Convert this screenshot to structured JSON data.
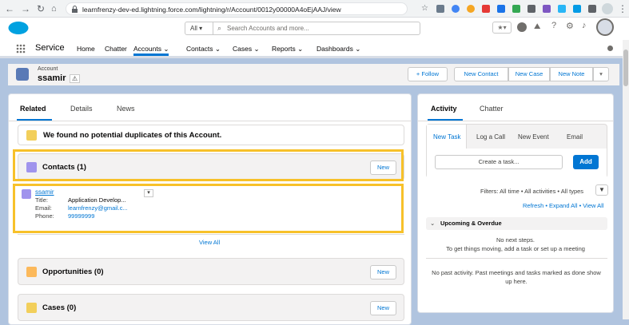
{
  "browser": {
    "url": "learnfrenzy-dev-ed.lightning.force.com/lightning/r/Account/0012y00000A4oEjAAJ/view"
  },
  "header": {
    "search_scope": "All",
    "search_placeholder": "Search Accounts and more..."
  },
  "nav": {
    "app_name": "Service",
    "items": [
      "Home",
      "Chatter",
      "Accounts",
      "Contacts",
      "Cases",
      "Reports",
      "Dashboards"
    ]
  },
  "record": {
    "type_label": "Account",
    "name": "ssamir",
    "buttons": [
      "+ Follow",
      "New Contact",
      "New Case",
      "New Note"
    ]
  },
  "left": {
    "tabs": [
      "Related",
      "Details",
      "News"
    ],
    "duplicates_msg": "We found no potential duplicates of this Account.",
    "contacts": {
      "title": "Contacts (1)",
      "new": "New",
      "name": "ssamir",
      "title_label": "Title:",
      "title_value": "Application Develop...",
      "email_label": "Email:",
      "email_value": "learnfrenzy@gmail.c...",
      "phone_label": "Phone:",
      "phone_value": "99999999",
      "view_all": "View All"
    },
    "opportunities": {
      "title": "Opportunities (0)",
      "new": "New"
    },
    "cases": {
      "title": "Cases (0)",
      "new": "New"
    }
  },
  "right": {
    "tabs": [
      "Activity",
      "Chatter"
    ],
    "subtabs": [
      "New Task",
      "Log a Call",
      "New Event",
      "Email"
    ],
    "task_placeholder": "Create a task...",
    "add": "Add",
    "filters": "Filters: All time • All activities • All types",
    "refresh": "Refresh • Expand All • View All",
    "upcoming": "Upcoming & Overdue",
    "no_next": "No next steps.",
    "no_next_hint": "To get things moving, add a task or set up a meeting",
    "no_past": "No past activity. Past meetings and tasks marked as done show up here."
  },
  "colors": {
    "brand": "#0176d3",
    "highlight": "#f7c12a",
    "contact_icon": "#a094ed",
    "opp_icon": "#fcb95b",
    "case_icon": "#f2cf5b"
  }
}
